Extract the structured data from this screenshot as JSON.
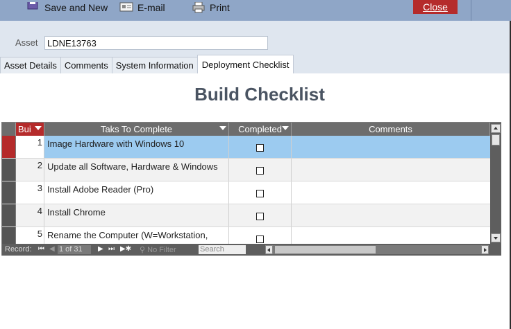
{
  "toolbar": {
    "save_new_label": "Save and New",
    "email_label": "E-mail",
    "print_label": "Print",
    "close_label": "Close"
  },
  "asset": {
    "label": "Asset",
    "value": "LDNE13763"
  },
  "tabs": [
    {
      "label": "Asset Details",
      "active": false
    },
    {
      "label": "Comments",
      "active": false
    },
    {
      "label": "System Information",
      "active": false
    },
    {
      "label": "Deployment Checklist",
      "active": true
    }
  ],
  "heading": "Build Checklist",
  "table": {
    "columns": [
      "Bui",
      "Taks To Complete",
      "Completed",
      "Comments"
    ],
    "rows": [
      {
        "num": "1",
        "task": "Image Hardware with Windows 10",
        "completed": false,
        "comments": ""
      },
      {
        "num": "2",
        "task": "Update all Software, Hardware & Windows",
        "completed": false,
        "comments": ""
      },
      {
        "num": "3",
        "task": "Install Adobe Reader (Pro)",
        "completed": false,
        "comments": ""
      },
      {
        "num": "4",
        "task": "Install Chrome",
        "completed": false,
        "comments": ""
      },
      {
        "num": "5",
        "task": "Rename the Computer (W=Workstation,",
        "completed": false,
        "comments": ""
      }
    ]
  },
  "navigation": {
    "record_label": "Record:",
    "position": "1 of 31",
    "filter_label": "No Filter",
    "search_placeholder": "Search"
  },
  "colors": {
    "accent_red": "#b52b2b",
    "toolbar_blue": "#8fa6c7",
    "selected_row": "#9ccbf0"
  }
}
